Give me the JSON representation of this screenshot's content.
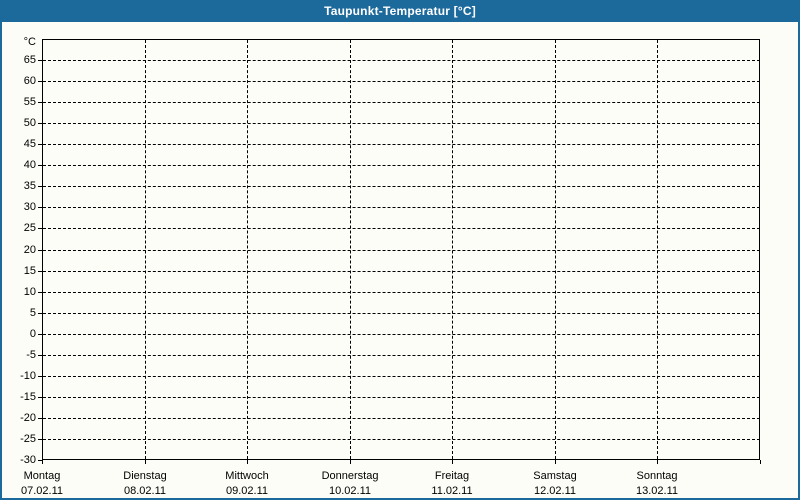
{
  "window": {
    "title": "Taupunkt-Temperatur [°C]"
  },
  "colors": {
    "titlebar_bg": "#1c699c",
    "titlebar_text": "#ffffff",
    "frame_border": "#1c699c",
    "page_bg": "#fdfdf8",
    "grid_color": "#000000",
    "text_color": "#000000"
  },
  "chart_data": {
    "type": "line",
    "title": "Taupunkt-Temperatur [°C]",
    "y_axis_unit": "°C",
    "y_ticks": [
      65,
      60,
      55,
      50,
      45,
      40,
      35,
      30,
      25,
      20,
      15,
      10,
      5,
      0,
      -5,
      -10,
      -15,
      -20,
      -25,
      -30
    ],
    "ylim": [
      -30,
      70
    ],
    "y_tick_step": 5,
    "x_categories": [
      {
        "day": "Montag",
        "date": "07.02.11"
      },
      {
        "day": "Dienstag",
        "date": "08.02.11"
      },
      {
        "day": "Mittwoch",
        "date": "09.02.11"
      },
      {
        "day": "Donnerstag",
        "date": "10.02.11"
      },
      {
        "day": "Freitag",
        "date": "11.02.11"
      },
      {
        "day": "Samstag",
        "date": "12.02.11"
      },
      {
        "day": "Sonntag",
        "date": "13.02.11"
      }
    ],
    "series": [],
    "grid": "dashed",
    "legend": "none"
  }
}
